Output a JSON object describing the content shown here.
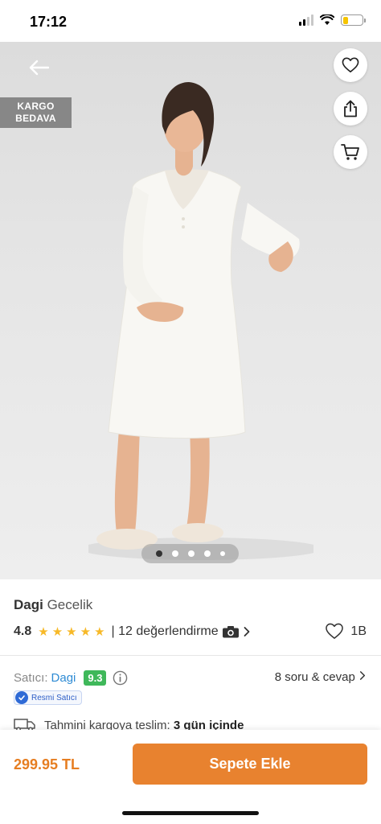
{
  "status_bar": {
    "time": "17:12"
  },
  "hero": {
    "badge_line1": "KARGO",
    "badge_line2": "BEDAVA",
    "image_count": 5,
    "active_image": 1
  },
  "product": {
    "brand": "Dagi",
    "name": "Gecelik",
    "rating": "4.8",
    "stars": 5,
    "reviews_label": "| 12 değerlendirme",
    "likes": "1B"
  },
  "seller": {
    "label": "Satıcı:",
    "name": "Dagi",
    "score": "9.3",
    "official_label": "Resmi Satıcı",
    "qa_label": "8 soru & cevap"
  },
  "delivery": {
    "label": "Tahmini kargoya teslim:",
    "value": "3 gün içinde"
  },
  "bottom_bar": {
    "price": "299.95 TL",
    "add_to_cart_label": "Sepete Ekle"
  },
  "colors": {
    "accent": "#e8822f",
    "price": "#e67e22",
    "star": "#f7b928",
    "score": "#3fb85a",
    "link": "#2e8bd4"
  },
  "icons": [
    "back-arrow-icon",
    "heart-icon",
    "share-icon",
    "cart-icon",
    "camera-icon",
    "chevron-right-icon",
    "info-icon",
    "check-icon",
    "truck-icon"
  ]
}
